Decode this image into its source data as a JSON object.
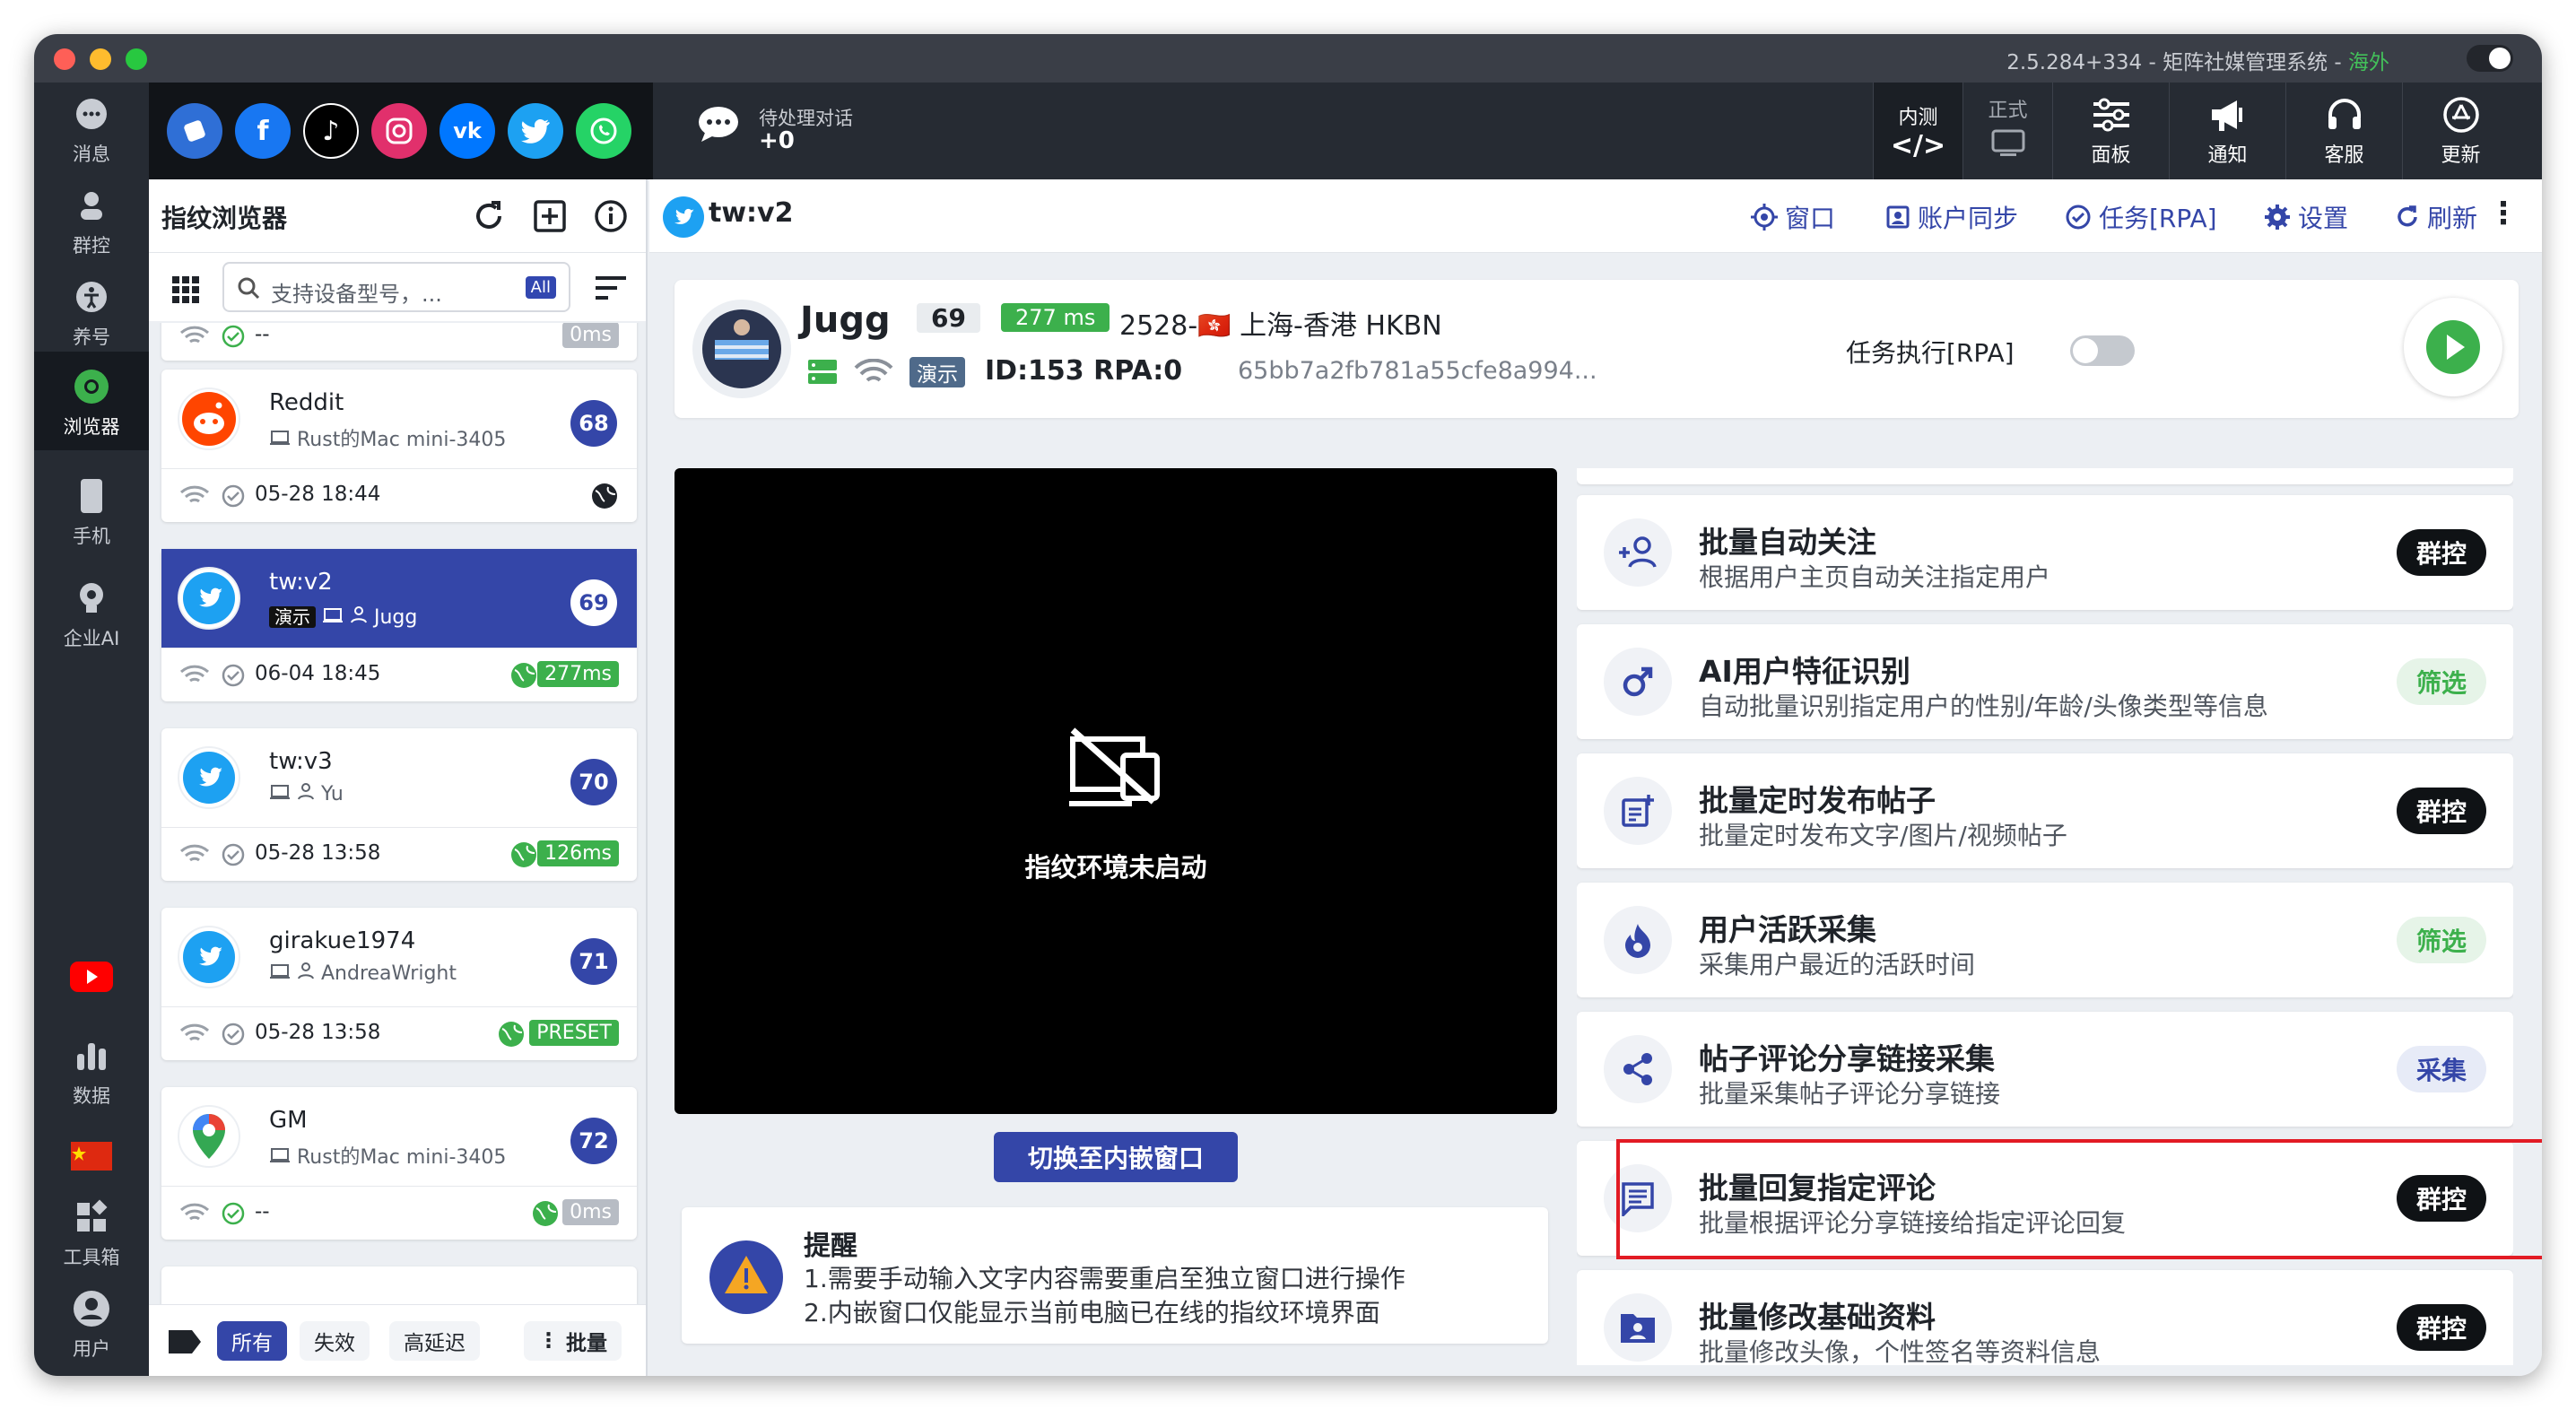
{
  "window": {
    "title": "2.5.284+334 - 矩阵社媒管理系统 - ",
    "title_suffix": "海外"
  },
  "leftnav": [
    {
      "label": "消息",
      "icon": "message-icon"
    },
    {
      "label": "群控",
      "icon": "group-control-icon"
    },
    {
      "label": "养号",
      "icon": "account-nurture-icon"
    },
    {
      "label": "浏览器",
      "icon": "browser-icon"
    },
    {
      "label": "手机",
      "icon": "phone-icon"
    },
    {
      "label": "企业AI",
      "icon": "enterprise-ai-icon"
    },
    {
      "label": "",
      "icon": "youtube-icon"
    },
    {
      "label": "数据",
      "icon": "data-chart-icon"
    },
    {
      "label": "",
      "icon": "china-flag-icon"
    },
    {
      "label": "工具箱",
      "icon": "toolbox-icon"
    },
    {
      "label": "用户",
      "icon": "user-icon"
    }
  ],
  "topbar": {
    "pending_label": "待处理对话",
    "pending_value": "+0",
    "buttons": [
      {
        "label": "内测",
        "sub": "</>",
        "icon": "code-icon"
      },
      {
        "label": "正式",
        "icon": "release-icon"
      },
      {
        "label": "面板",
        "icon": "sliders-icon"
      },
      {
        "label": "通知",
        "icon": "megaphone-icon"
      },
      {
        "label": "客服",
        "icon": "headset-icon"
      },
      {
        "label": "更新",
        "icon": "app-store-icon"
      }
    ]
  },
  "sidebar": {
    "title": "指纹浏览器",
    "search_placeholder": "支持设备型号，...",
    "search_all": "All",
    "cards": [
      {
        "name": "",
        "sub": "",
        "date": "--",
        "ms": "0ms",
        "num": ""
      },
      {
        "name": "Reddit",
        "sub": "Rust的Mac mini-3405",
        "num": "68",
        "date": "05-28 18:44",
        "ms": ""
      },
      {
        "name": "tw:v2",
        "demo": "演示",
        "sub": "Jugg",
        "num": "69",
        "date": "06-04 18:45",
        "ms": "277ms"
      },
      {
        "name": "tw:v3",
        "sub": "Yu",
        "num": "70",
        "date": "05-28 13:58",
        "ms": "126ms"
      },
      {
        "name": "girakue1974",
        "sub": "AndreaWright",
        "num": "71",
        "date": "05-28 13:58",
        "ms": "PRESET"
      },
      {
        "name": "GM",
        "sub": "Rust的Mac mini-3405",
        "num": "72",
        "date": "--",
        "ms": "0ms"
      }
    ],
    "footer": {
      "all": "所有",
      "invalid": "失效",
      "high_latency": "高延迟",
      "batch": "批量"
    }
  },
  "main": {
    "account": "tw:v2",
    "links": [
      "窗口",
      "账户同步",
      "任务[RPA]",
      "设置",
      "刷新"
    ],
    "profile": {
      "name": "Jugg",
      "num": "69",
      "ms": "277 ms",
      "location": "2528-🇭🇰 上海-香港 HKBN",
      "demo": "演示",
      "id_rpa": "ID:153  RPA:0",
      "hash": "65bb7a2fb781a55cfe8a994...",
      "rpa_label": "任务执行[RPA]"
    },
    "screen_msg": "指纹环境未启动",
    "embed_button": "切换至内嵌窗口",
    "reminder": {
      "title": "提醒",
      "line1": "1.需要手动输入文字内容需要重启至独立窗口进行操作",
      "line2": "2.内嵌窗口仅能显示当前电脑已在线的指纹环境界面"
    },
    "tasks": [
      {
        "title": "批量自动关注",
        "desc": "根据用户主页自动关注指定用户",
        "badge": "群控",
        "style": "dark",
        "icon": "add-person-icon"
      },
      {
        "title": "AI用户特征识别",
        "desc": "自动批量识别指定用户的性别/年龄/头像类型等信息",
        "badge": "筛选",
        "style": "green",
        "icon": "gender-icon"
      },
      {
        "title": "批量定时发布帖子",
        "desc": "批量定时发布文字/图片/视频帖子",
        "badge": "群控",
        "style": "dark",
        "icon": "post-add-icon"
      },
      {
        "title": "用户活跃采集",
        "desc": "采集用户最近的活跃时间",
        "badge": "筛选",
        "style": "green",
        "icon": "flame-icon"
      },
      {
        "title": "帖子评论分享链接采集",
        "desc": "批量采集帖子评论分享链接",
        "badge": "采集",
        "style": "blue",
        "icon": "share-icon"
      },
      {
        "title": "批量回复指定评论",
        "desc": "批量根据评论分享链接给指定评论回复",
        "badge": "群控",
        "style": "dark",
        "icon": "comment-icon"
      },
      {
        "title": "批量修改基础资料",
        "desc": "批量修改头像，个性签名等资料信息",
        "badge": "群控",
        "style": "dark",
        "icon": "profile-folder-icon"
      }
    ]
  },
  "colors": {
    "accent": "#3446a8",
    "green": "#3cb04c",
    "highlight": "#e21b24"
  }
}
